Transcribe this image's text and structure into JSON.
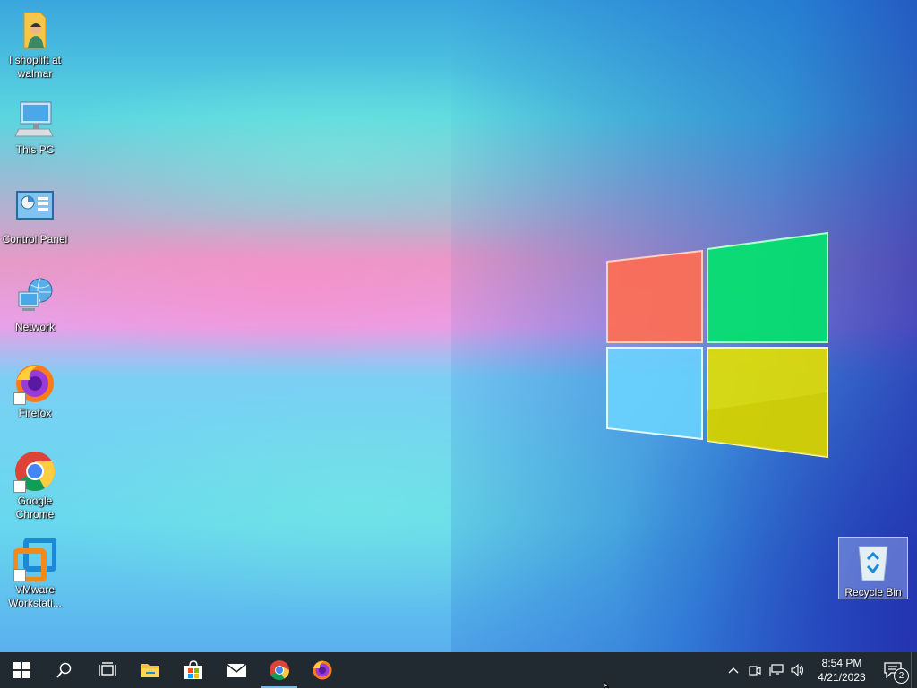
{
  "desktop_icons": [
    {
      "label": "I shoplift at walmar",
      "icon": "folder-user-icon"
    },
    {
      "label": "This PC",
      "icon": "computer-icon"
    },
    {
      "label": "Control Panel",
      "icon": "control-panel-icon"
    },
    {
      "label": "Network",
      "icon": "network-icon"
    },
    {
      "label": "Firefox",
      "icon": "firefox-icon"
    },
    {
      "label": "Google Chrome",
      "icon": "chrome-icon"
    },
    {
      "label": "VMware Workstati...",
      "icon": "vmware-icon"
    },
    {
      "label": "Recycle Bin",
      "icon": "recycle-bin-icon"
    }
  ],
  "taskbar": {
    "pinned": [
      "start-icon",
      "search-icon",
      "task-view-icon",
      "file-explorer-icon",
      "store-icon",
      "mail-icon",
      "chrome-icon",
      "firefox-icon"
    ],
    "active_app": "chrome-icon",
    "tray": {
      "icons": [
        "chevron-up-icon",
        "meet-now-icon",
        "network-icon",
        "volume-icon"
      ],
      "time": "8:54 PM",
      "date": "4/21/2023",
      "notification_count": "2"
    }
  },
  "colors": {
    "taskbar": "#202a30",
    "logo_red": "#ff6a4a",
    "logo_green": "#00e070",
    "logo_blue": "#60d0ff",
    "logo_yellow": "#e8e000"
  }
}
